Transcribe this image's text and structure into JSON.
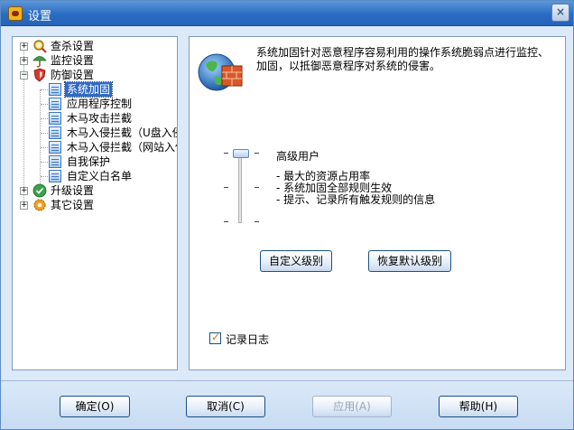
{
  "window": {
    "title": "设置",
    "close_label": "×"
  },
  "tree": {
    "items": [
      {
        "label": "查杀设置",
        "expander": "+"
      },
      {
        "label": "监控设置",
        "expander": "+"
      },
      {
        "label": "防御设置",
        "expander": "−"
      },
      {
        "label": "系统加固"
      },
      {
        "label": "应用程序控制"
      },
      {
        "label": "木马攻击拦截"
      },
      {
        "label": "木马入侵拦截（U盘入侵"
      },
      {
        "label": "木马入侵拦截（网站入侵"
      },
      {
        "label": "自我保护"
      },
      {
        "label": "自定义白名单"
      },
      {
        "label": "升级设置",
        "expander": "+"
      },
      {
        "label": "其它设置",
        "expander": "+"
      }
    ],
    "selected": "系统加固"
  },
  "main": {
    "description": "系统加固针对恶意程序容易利用的操作系统脆弱点进行监控、加固，以抵御恶意程序对系统的侵害。",
    "level": {
      "title": "高级用户",
      "lines": [
        "- 最大的资源占用率",
        "- 系统加固全部规则生效",
        "- 提示、记录所有触发规则的信息"
      ],
      "position": "top"
    },
    "custom_level_button": "自定义级别",
    "restore_default_button": "恢复默认级别",
    "log_checkbox": {
      "label": "记录日志",
      "checked": true
    }
  },
  "footer": {
    "ok": "确定(O)",
    "cancel": "取消(C)",
    "apply": "应用(A)",
    "help": "帮助(H)"
  },
  "colors": {
    "titlebar": "#2a6cc4",
    "selection": "#316ac5",
    "panel_border": "#7f9db9"
  }
}
